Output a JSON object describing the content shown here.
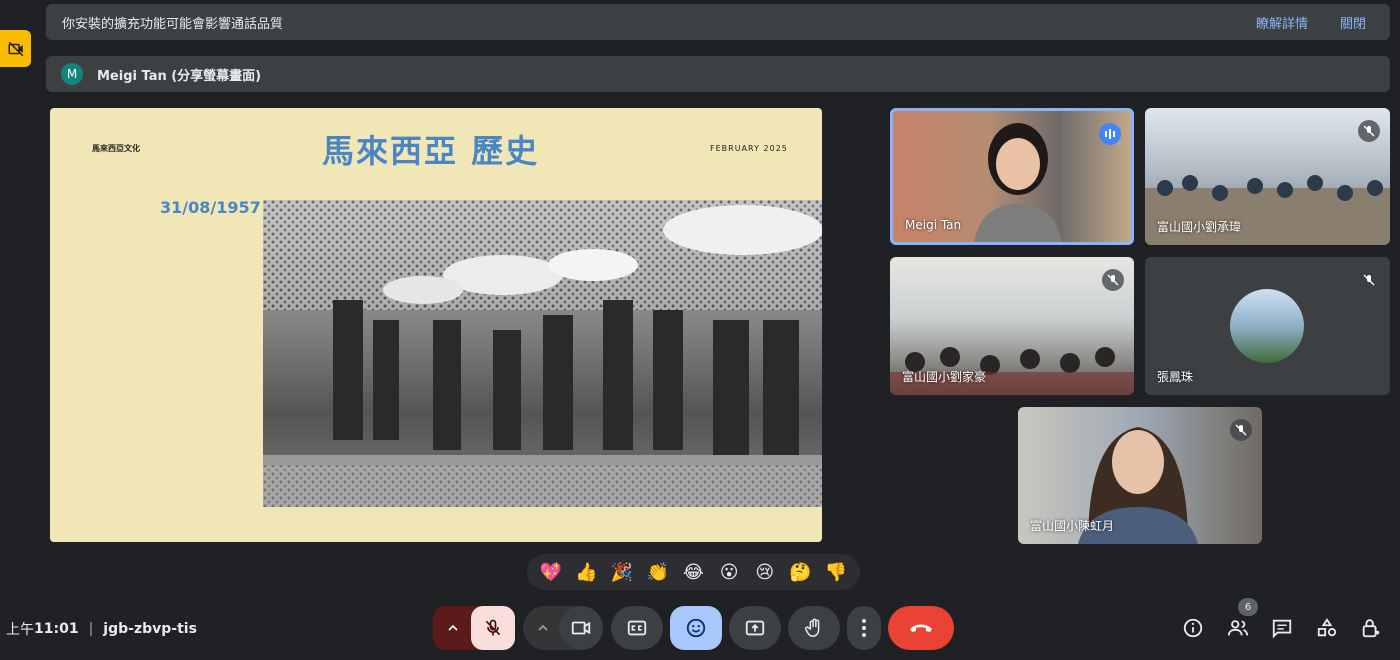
{
  "extension_banner": {
    "message": "你安裝的擴充功能可能會影響通話品質",
    "details_link": "瞭解詳情",
    "close_link": "關閉"
  },
  "presenting_banner": {
    "avatar_letter": "M",
    "presenter": "Meigi Tan (分享螢幕畫面)"
  },
  "slide": {
    "top_left": "馬來西亞文化",
    "title": "馬來西亞 歷史",
    "top_right": "FEBRUARY 2025",
    "date": "31/08/1957"
  },
  "participants": [
    {
      "name": "Meigi Tan",
      "speaking": true
    },
    {
      "name": "富山國小劉承瑋",
      "muted": true
    },
    {
      "name": "富山國小劉家豪",
      "muted": true
    },
    {
      "name": "張鳳珠",
      "muted": true
    },
    {
      "name": "富山國小陳虹月",
      "muted": true
    }
  ],
  "reactions": [
    "💖",
    "👍",
    "🎉",
    "👏",
    "😂",
    "😮",
    "😢",
    "🤔",
    "👎"
  ],
  "meeting": {
    "time_prefix": "上午",
    "time": "11:01",
    "code": "jgb-zbvp-tis"
  },
  "people_count": "6",
  "colors": {
    "background": "#202124",
    "accent": "#8ab4f8",
    "leave": "#ea4335",
    "mic_muted": "#f9dedc",
    "slide_bg": "#f1e6b6",
    "slide_title": "#4a86c5"
  }
}
